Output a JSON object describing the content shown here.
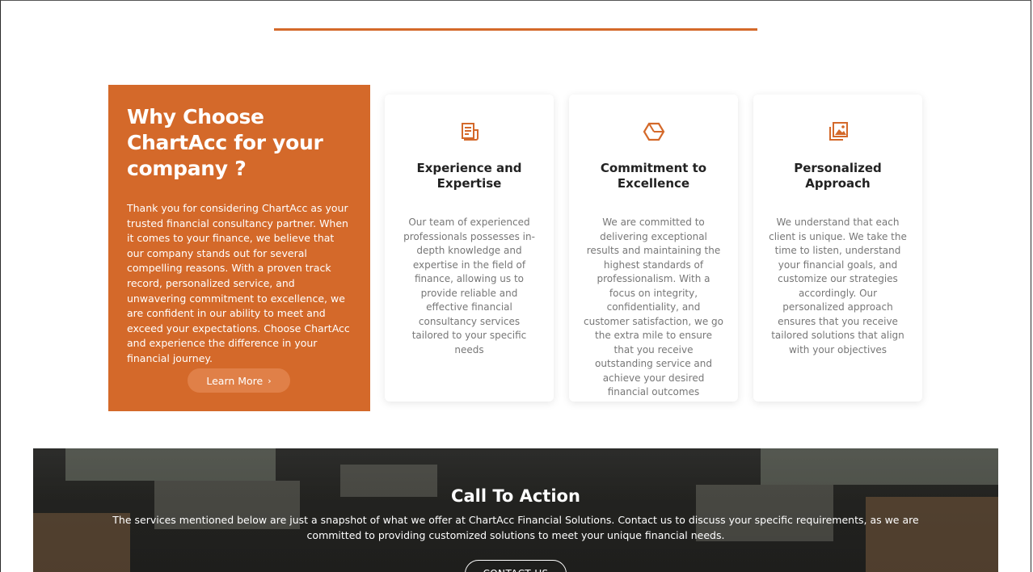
{
  "colors": {
    "accent": "#d4692a",
    "button_fill": "#e08048",
    "card_text": "#777777"
  },
  "why": {
    "title": "Why Choose ChartAcc for your company ?",
    "text": "Thank you for considering ChartAcc as your trusted financial consultancy partner. When it comes to your finance, we believe that our company stands out for several compelling reasons. With a proven track record, personalized service, and unwavering commitment to excellence, we are confident in our ability to meet and exceed your expectations. Choose ChartAcc and experience the difference in your financial journey.",
    "button_label": "Learn More",
    "button_icon": "chevron-right-icon"
  },
  "cards": [
    {
      "icon": "document-icon",
      "title": "Experience and Expertise",
      "text": "Our team of experienced professionals possesses in-depth knowledge and expertise in the field of finance, allowing us to provide reliable and effective financial consultancy services tailored to your specific needs"
    },
    {
      "icon": "hexagon-icon",
      "title": "Commitment to Excellence",
      "text": "We are committed to delivering exceptional results and maintaining the highest standards of professionalism. With a focus on integrity, confidentiality, and customer satisfaction, we go the extra mile to ensure that you receive outstanding service and achieve your desired financial outcomes"
    },
    {
      "icon": "image-gallery-icon",
      "title": "Personalized Approach",
      "text": "We understand that each client is unique. We take the time to listen, understand your financial goals, and customize our strategies accordingly. Our personalized approach ensures that you receive tailored solutions that align with your objectives"
    }
  ],
  "cta": {
    "title": "Call To Action",
    "text": "The services mentioned below are just a snapshot of what we offer at ChartAcc Financial Solutions. Contact us to discuss your specific requirements, as we are committed to providing customized solutions to meet your unique financial needs.",
    "button_label": "CONTACT US"
  }
}
